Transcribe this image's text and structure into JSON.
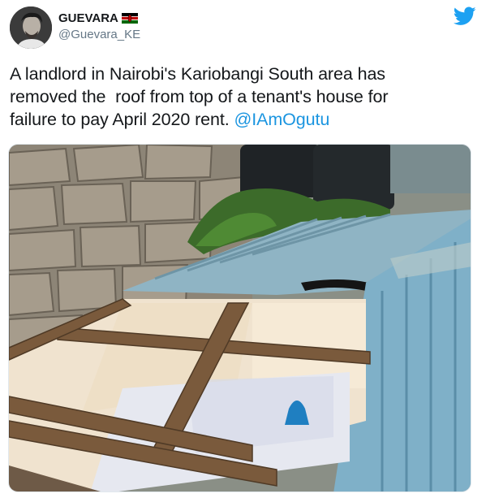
{
  "author": {
    "display_name": "GUEVARA",
    "flag_icon": "kenya-flag-icon",
    "handle": "@Guevara_KE",
    "avatar_icon": "user-avatar"
  },
  "platform_icon": "twitter-bird-icon",
  "tweet": {
    "text_line1": "A landlord in Nairobi's Kariobangi South area has",
    "text_line2": "removed the  roof from top of a tenant's house for",
    "text_line3": "failure to pay April 2020 rent.",
    "mention": "@IAmOgutu"
  },
  "media": {
    "type": "photo"
  },
  "colors": {
    "link": "#1b95e0",
    "twitter_blue": "#1da1f2",
    "handle_gray": "#657786"
  }
}
